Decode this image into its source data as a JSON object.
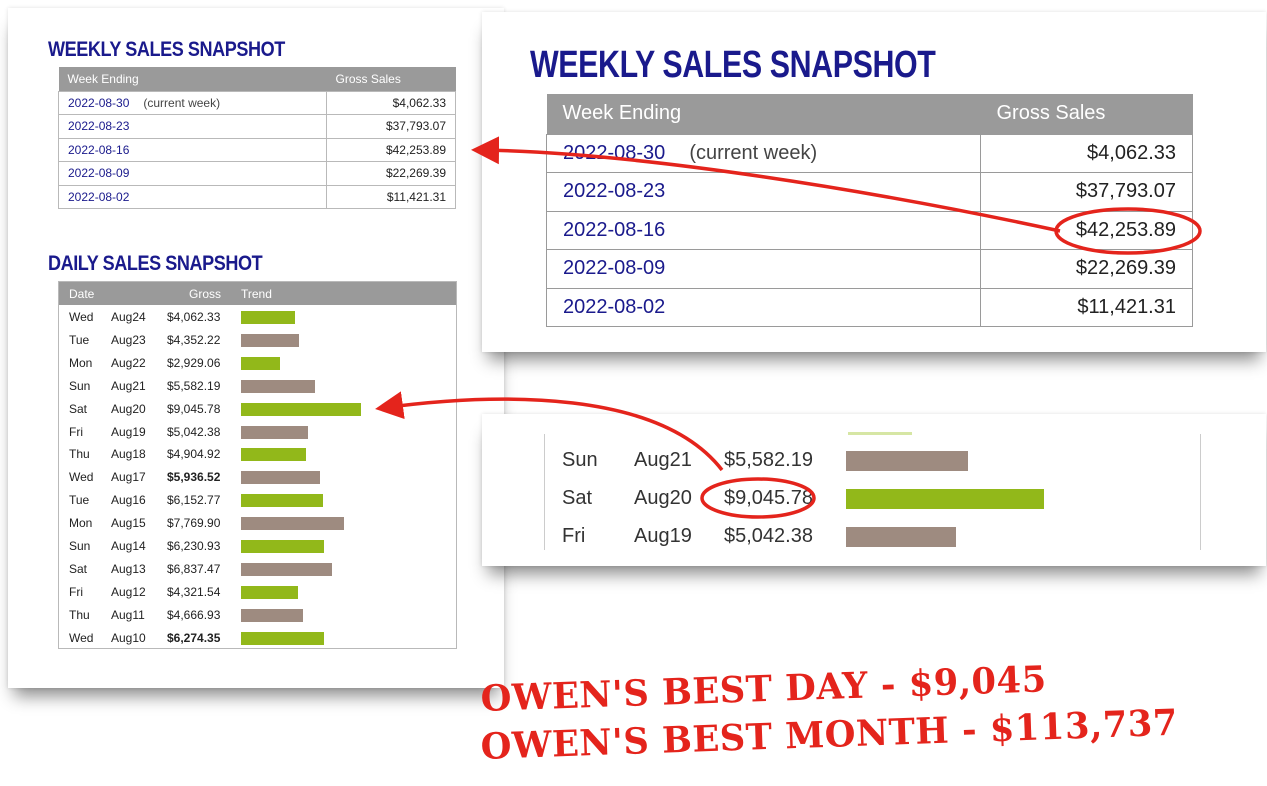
{
  "colors": {
    "title": "#1a1a8c",
    "header_bg": "#9a9a9a",
    "bar_green": "#92b81a",
    "bar_taupe": "#9e8b80",
    "annotation_red": "#e4241c"
  },
  "weekly": {
    "title": "WEEKLY SALES SNAPSHOT",
    "headers": [
      "Week Ending",
      "Gross Sales"
    ],
    "rows": [
      {
        "date": "2022-08-30",
        "note": "(current week)",
        "amount": "$4,062.33"
      },
      {
        "date": "2022-08-23",
        "note": "",
        "amount": "$37,793.07"
      },
      {
        "date": "2022-08-16",
        "note": "",
        "amount": "$42,253.89"
      },
      {
        "date": "2022-08-09",
        "note": "",
        "amount": "$22,269.39"
      },
      {
        "date": "2022-08-02",
        "note": "",
        "amount": "$11,421.31"
      }
    ]
  },
  "daily": {
    "title": "DAILY SALES SNAPSHOT",
    "headers": [
      "Date",
      "Gross",
      "Trend"
    ],
    "rows": [
      {
        "day": "Wed",
        "date": "Aug24",
        "gross": "$4,062.33",
        "value": 4062.33,
        "bar": "green",
        "bold": false
      },
      {
        "day": "Tue",
        "date": "Aug23",
        "gross": "$4,352.22",
        "value": 4352.22,
        "bar": "taupe",
        "bold": false
      },
      {
        "day": "Mon",
        "date": "Aug22",
        "gross": "$2,929.06",
        "value": 2929.06,
        "bar": "green",
        "bold": false
      },
      {
        "day": "Sun",
        "date": "Aug21",
        "gross": "$5,582.19",
        "value": 5582.19,
        "bar": "taupe",
        "bold": false
      },
      {
        "day": "Sat",
        "date": "Aug20",
        "gross": "$9,045.78",
        "value": 9045.78,
        "bar": "green",
        "bold": false
      },
      {
        "day": "Fri",
        "date": "Aug19",
        "gross": "$5,042.38",
        "value": 5042.38,
        "bar": "taupe",
        "bold": false
      },
      {
        "day": "Thu",
        "date": "Aug18",
        "gross": "$4,904.92",
        "value": 4904.92,
        "bar": "green",
        "bold": false
      },
      {
        "day": "Wed",
        "date": "Aug17",
        "gross": "$5,936.52",
        "value": 5936.52,
        "bar": "taupe",
        "bold": true
      },
      {
        "day": "Tue",
        "date": "Aug16",
        "gross": "$6,152.77",
        "value": 6152.77,
        "bar": "green",
        "bold": false
      },
      {
        "day": "Mon",
        "date": "Aug15",
        "gross": "$7,769.90",
        "value": 7769.9,
        "bar": "taupe",
        "bold": false
      },
      {
        "day": "Sun",
        "date": "Aug14",
        "gross": "$6,230.93",
        "value": 6230.93,
        "bar": "green",
        "bold": false
      },
      {
        "day": "Sat",
        "date": "Aug13",
        "gross": "$6,837.47",
        "value": 6837.47,
        "bar": "taupe",
        "bold": false
      },
      {
        "day": "Fri",
        "date": "Aug12",
        "gross": "$4,321.54",
        "value": 4321.54,
        "bar": "green",
        "bold": false
      },
      {
        "day": "Thu",
        "date": "Aug11",
        "gross": "$4,666.93",
        "value": 4666.93,
        "bar": "taupe",
        "bold": false
      },
      {
        "day": "Wed",
        "date": "Aug10",
        "gross": "$6,274.35",
        "value": 6274.35,
        "bar": "green",
        "bold": true
      }
    ]
  },
  "zoom_daily": [
    {
      "day": "Sun",
      "date": "Aug21",
      "gross": "$5,582.19",
      "value": 5582.19,
      "bar": "taupe"
    },
    {
      "day": "Sat",
      "date": "Aug20",
      "gross": "$9,045.78",
      "value": 9045.78,
      "bar": "green"
    },
    {
      "day": "Fri",
      "date": "Aug19",
      "gross": "$5,042.38",
      "value": 5042.38,
      "bar": "taupe"
    }
  ],
  "callouts": {
    "best_day": "OWEN'S BEST DAY - $9,045",
    "best_month": "OWEN'S BEST MONTH - $113,737"
  }
}
